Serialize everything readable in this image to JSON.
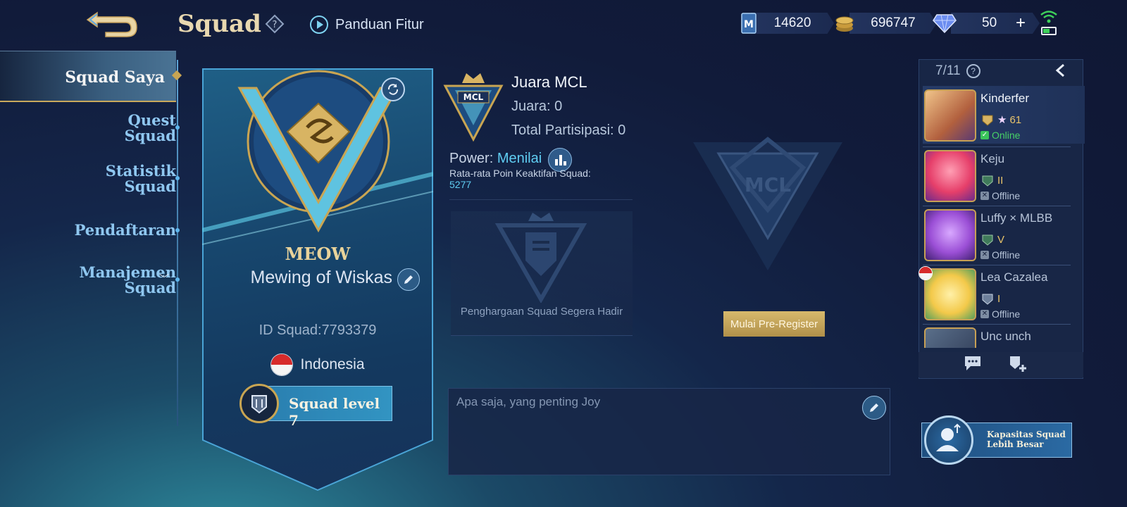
{
  "header": {
    "title": "Squad",
    "guide_label": "Panduan Fitur",
    "currencies": [
      {
        "name": "ticket",
        "value": "14620",
        "icon": "ticket-icon"
      },
      {
        "name": "battle-points",
        "value": "696747",
        "icon": "coin-icon"
      },
      {
        "name": "diamonds",
        "value": "50",
        "icon": "diamond-icon"
      }
    ]
  },
  "nav": {
    "items": [
      {
        "label": "Squad Saya",
        "active": true
      },
      {
        "label": "Quest Squad"
      },
      {
        "label": "Statistik Squad"
      },
      {
        "label": "Pendaftaran"
      },
      {
        "label": "Manajemen Squad"
      }
    ]
  },
  "squad": {
    "short_name": "MEOW",
    "name": "Mewing of Wiskas",
    "id_text": "ID Squad:7793379",
    "country": "Indonesia",
    "level_label": "Squad level 7"
  },
  "mcl": {
    "title": "Juara MCL",
    "champion": "Juara: 0",
    "participation": "Total Partisipasi: 0",
    "power_label": "Power:",
    "power_value": "Menilai",
    "avg_label": "Rata-rata Poin Keaktifan Squad:",
    "avg_value": "5277",
    "award_text": "Penghargaan Squad Segera Hadir",
    "prereg_label": "Mulai Pre-Register"
  },
  "description": {
    "text": "Apa saja, yang penting Joy"
  },
  "members": {
    "count": "7/11",
    "list": [
      {
        "name": "Kinderfer",
        "rank": "61",
        "status": "Online",
        "online": true
      },
      {
        "name": "Keju",
        "rank": "II",
        "status": "Offline",
        "online": false
      },
      {
        "name": "Luffy × MLBB",
        "rank": "V",
        "status": "Offline",
        "online": false
      },
      {
        "name": "Lea Cazalea",
        "rank": "I",
        "status": "Offline",
        "online": false
      },
      {
        "name": "Unc unch",
        "rank": "",
        "status": "",
        "online": false
      }
    ],
    "capacity_line1": "Kapasitas Squad",
    "capacity_line2": "Lebih Besar"
  },
  "colors": {
    "accent_gold": "#c9a552",
    "accent_cyan": "#5fcdf2",
    "online_green": "#3bc45a"
  }
}
